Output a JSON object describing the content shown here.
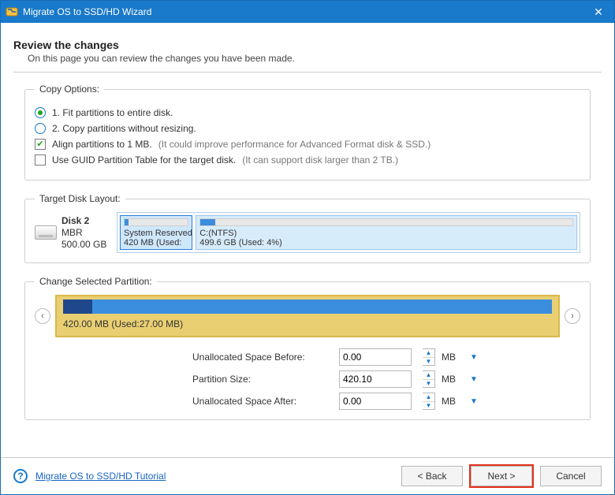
{
  "window": {
    "title": "Migrate OS to SSD/HD Wizard"
  },
  "header": {
    "title": "Review the changes",
    "subtitle": "On this page you can review the changes you have been made."
  },
  "copy_options": {
    "legend": "Copy Options:",
    "radio1": "1. Fit partitions to entire disk.",
    "radio2": "2. Copy partitions without resizing.",
    "radio_selected": 1,
    "align_label": "Align partitions to 1 MB.",
    "align_note": "(It could improve performance for Advanced Format disk & SSD.)",
    "align_checked": true,
    "gpt_label": "Use GUID Partition Table for the target disk.",
    "gpt_note": "(It can support disk larger than 2 TB.)",
    "gpt_checked": false
  },
  "target_layout": {
    "legend": "Target Disk Layout:",
    "disk": {
      "name": "Disk 2",
      "type": "MBR",
      "size": "500.00 GB"
    },
    "partitions": [
      {
        "name": "System Reserved",
        "sub": "420 MB (Used:",
        "used_pct": 6,
        "width_pct": 16,
        "selected": true
      },
      {
        "name": "C:(NTFS)",
        "sub": "499.6 GB (Used: 4%)",
        "used_pct": 4,
        "width_pct": 84,
        "selected": false
      }
    ]
  },
  "change_partition": {
    "legend": "Change Selected Partition:",
    "bar_label": "420.00 MB (Used:27.00 MB)",
    "used_pct": 6
  },
  "fields": {
    "before": {
      "label": "Unallocated Space Before:",
      "value": "0.00",
      "unit": "MB"
    },
    "size": {
      "label": "Partition Size:",
      "value": "420.10",
      "unit": "MB"
    },
    "after": {
      "label": "Unallocated Space After:",
      "value": "0.00",
      "unit": "MB"
    }
  },
  "footer": {
    "help_link": "Migrate OS to SSD/HD Tutorial",
    "back": "< Back",
    "next": "Next >",
    "cancel": "Cancel"
  }
}
